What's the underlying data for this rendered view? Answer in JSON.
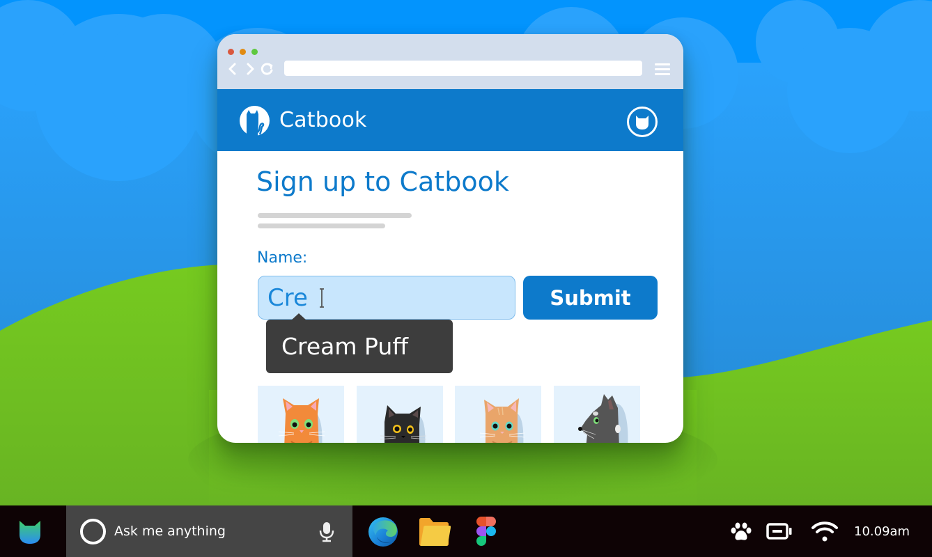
{
  "colors": {
    "sky": "#0394fd",
    "cloud": "#27a0fb",
    "hill": "#74c820",
    "brand": "#0d7acb",
    "chrome": "#d3deed",
    "input_bg": "#c8e6fd",
    "tooltip_bg": "#3d3d3d",
    "taskbar": "#0e0305",
    "search_bg": "#454545"
  },
  "browser": {
    "window_controls": [
      "close",
      "minimize",
      "maximize"
    ],
    "nav": {
      "back_icon": "chevron-left-icon",
      "forward_icon": "chevron-right-icon",
      "reload_icon": "reload-icon",
      "menu_icon": "hamburger-menu-icon"
    },
    "address_value": ""
  },
  "site": {
    "name": "Catbook",
    "logo_icon": "cat-silhouette-icon",
    "profile_icon": "cat-face-icon"
  },
  "form": {
    "title": "Sign up to Catbook",
    "name_label": "Name:",
    "name_value": "Cre",
    "submit_label": "Submit",
    "autocomplete_suggestion": "Cream Puff"
  },
  "cats": [
    {
      "name": "orange-tabby-cat",
      "fur": "#f28a3a",
      "eyes": "#7fe07a"
    },
    {
      "name": "black-cat",
      "fur": "#2a2a2a",
      "eyes": "#f3c11b"
    },
    {
      "name": "ginger-striped-cat",
      "fur": "#e9a56a",
      "eyes": "#63d8c8"
    },
    {
      "name": "grey-cat-profile",
      "fur": "#555555",
      "eyes": "#7fe07a"
    }
  ],
  "taskbar": {
    "start_icon": "cat-head-icon",
    "search_placeholder": "Ask me anything",
    "search_icon": "cortana-ring-icon",
    "mic_icon": "microphone-icon",
    "apps": [
      {
        "name": "Edge",
        "icon": "edge-browser-icon"
      },
      {
        "name": "File Explorer",
        "icon": "folder-icon"
      },
      {
        "name": "Figma",
        "icon": "figma-icon"
      }
    ],
    "tray": [
      "paw-icon",
      "battery-icon",
      "wifi-icon"
    ],
    "time": "10.09am"
  }
}
